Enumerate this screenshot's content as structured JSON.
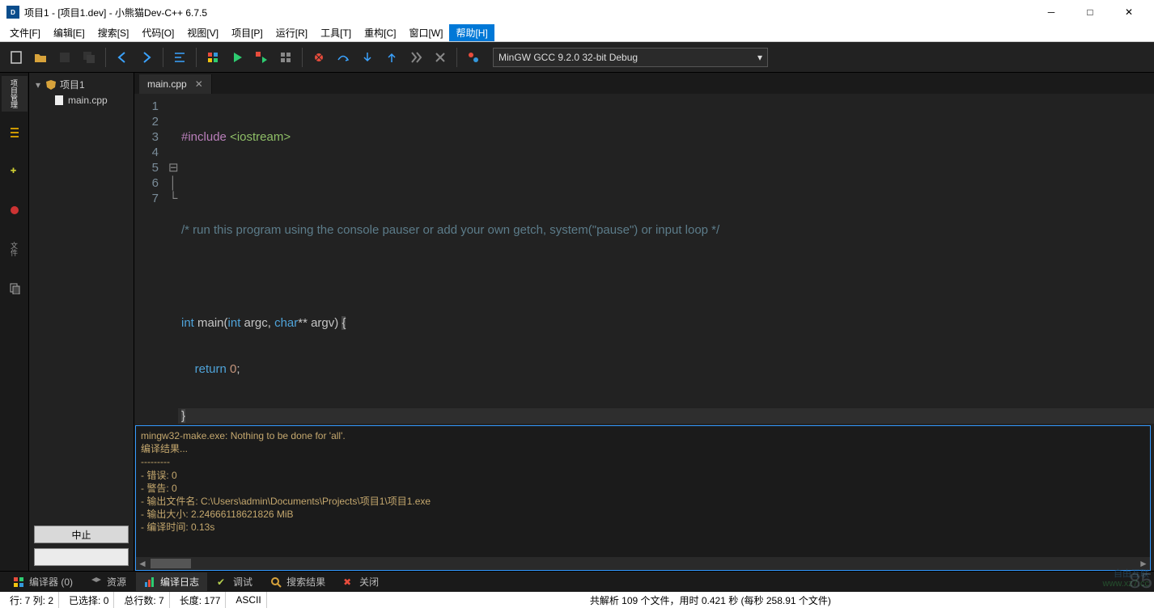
{
  "window": {
    "title": "项目1 - [项目1.dev] - 小熊猫Dev-C++ 6.7.5",
    "app_icon_text": "Dev"
  },
  "menu": {
    "file": "文件[F]",
    "edit": "编辑[E]",
    "search": "搜索[S]",
    "code": "代码[O]",
    "view": "视图[V]",
    "project": "项目[P]",
    "run": "运行[R]",
    "tools": "工具[T]",
    "refactor": "重构[C]",
    "window": "窗口[W]",
    "help": "帮助[H]"
  },
  "compiler": {
    "selected": "MinGW GCC 9.2.0 32-bit Debug"
  },
  "switcher": {
    "project_mgr": "项目管理",
    "struct": "结构",
    "watch": "监视",
    "debug": "debug",
    "files": "文件"
  },
  "tree": {
    "root": "项目1",
    "child": "main.cpp"
  },
  "leftbtns": {
    "stop": "中止",
    "blank": " "
  },
  "tab": {
    "name": "main.cpp"
  },
  "code": {
    "l1": {
      "a": "#include",
      "b": "<iostream>"
    },
    "l3": "/* run this program using the console pauser or add your own getch, system(\"pause\") or input loop */",
    "l5": {
      "int": "int",
      "main": "main",
      "open": "(",
      "int2": "int",
      "argc": " argc, ",
      "char": "char",
      "argv": "** argv) ",
      "brace": "{"
    },
    "l6": {
      "ret": "return",
      "zero": " 0",
      "semi": ";"
    },
    "l7": "}"
  },
  "gutter": {
    "l1": "1",
    "l2": "2",
    "l3": "3",
    "l4": "4",
    "l5": "5",
    "l6": "6",
    "l7": "7"
  },
  "output": {
    "l1": "mingw32-make.exe: Nothing to be done for 'all'.",
    "l2": "",
    "l3": "编译结果...",
    "l4": "---------",
    "l5": "- 错误: 0",
    "l6": "- 警告: 0",
    "l7": "- 输出文件名: C:\\Users\\admin\\Documents\\Projects\\项目1\\项目1.exe",
    "l8": "- 输出大小: 2.24666118621826 MiB",
    "l9": "- 编译时间: 0.13s"
  },
  "bottomtabs": {
    "compiler": "编译器 (0)",
    "resources": "资源",
    "log": "编译日志",
    "debug": "调试",
    "findresults": "搜索结果",
    "close": "关闭"
  },
  "status": {
    "line_col": "行:   7   列:   2",
    "sel": "已选择:    0",
    "totallines": "总行数:    7",
    "length": "长度:   177",
    "encoding": "ASCII",
    "parse": "共解析 109 个文件，用时 0.421 秒 (每秒 258.91 个文件)"
  },
  "watermark": {
    "brand": "自由互联",
    "url": "www.xz7.cc",
    "big": "85"
  }
}
